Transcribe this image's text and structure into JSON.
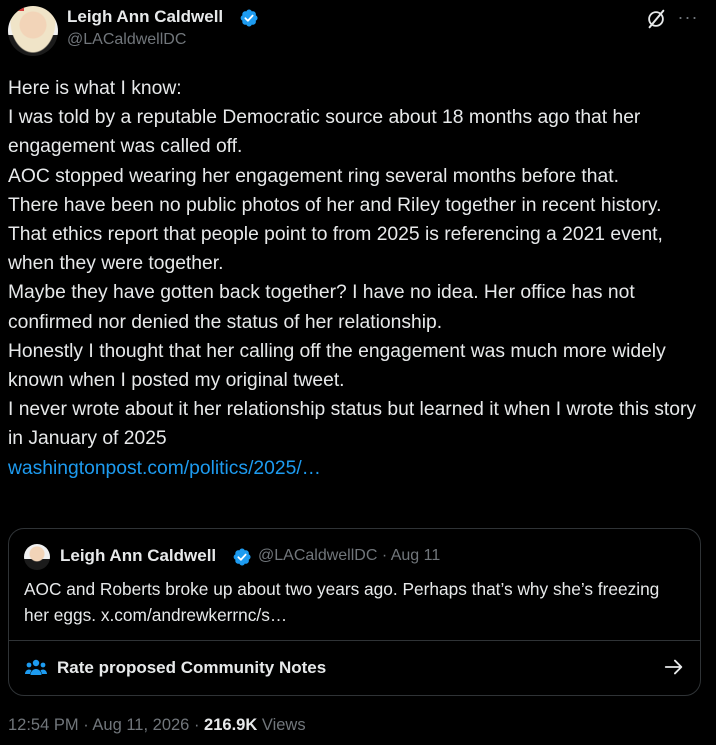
{
  "author": {
    "display_name": "Leigh Ann Caldwell",
    "handle": "@LACaldwellDC",
    "verified_icon": "verified-badge-icon"
  },
  "tweet": {
    "lines": [
      "Here is what I know:",
      "I was told by a reputable Democratic source about 18 months ago that her engagement was called off.",
      "AOC stopped wearing her engagement ring several months before that.",
      "There have been no public photos of her and Riley together in recent history.",
      "That ethics report that people point to from 2025 is referencing a 2021 event, when they were together.",
      "Maybe they have gotten back together? I have no idea. Her office has not confirmed nor denied the status of her relationship.",
      "Honestly I thought that her calling off the engagement was much more widely known when I posted my original tweet.",
      "I never wrote about it her relationship status but learned it when I wrote this story in January of 2025"
    ],
    "link": "washingtonpost.com/politics/2025/…"
  },
  "quoted": {
    "display_name": "Leigh Ann Caldwell",
    "handle": "@LACaldwellDC",
    "separator": "·",
    "date": "Aug 11",
    "text": "AOC and Roberts broke up about two years ago. Perhaps that’s why she’s freezing her eggs. x.com/andrewkerrnc/s…",
    "community_notes_label": "Rate proposed Community Notes"
  },
  "footer": {
    "time": "12:54 PM",
    "sep1": "·",
    "date": "Aug 11, 2026",
    "sep2": "·",
    "views_count": "216.9K",
    "views_label": "Views"
  },
  "colors": {
    "background": "#000000",
    "text": "#e7e9ea",
    "muted": "#71767b",
    "link": "#1d9bf0",
    "border": "#2f3336",
    "verified": "#1d9bf0"
  }
}
